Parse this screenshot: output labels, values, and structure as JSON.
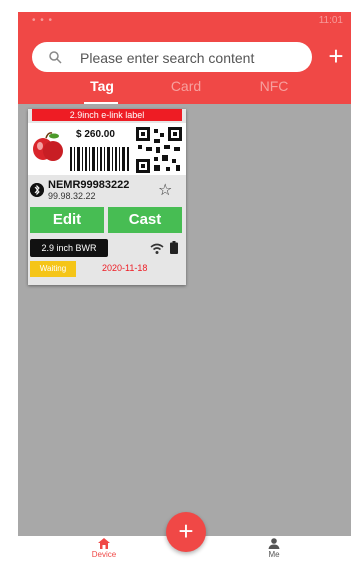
{
  "status_bar": {
    "left_text": "• • •",
    "right_text": "11:01"
  },
  "search": {
    "placeholder": "Please enter search content"
  },
  "header": {
    "add_label": "+"
  },
  "tabs": [
    {
      "label": "Tag",
      "active": true
    },
    {
      "label": "Card",
      "active": false
    },
    {
      "label": "NFC",
      "active": false
    }
  ],
  "device_card": {
    "label_title": "2.9inch e-link label",
    "price": "$ 260.00",
    "device_id": "NEMR99983222",
    "ip": "99.98.32.22",
    "edit_label": "Edit",
    "cast_label": "Cast",
    "model": "2.9 inch BWR",
    "status": "Waiting",
    "date": "2020-11-18",
    "star_icon": "star-outline-icon"
  },
  "fab": {
    "label": "+"
  },
  "bottom_nav": [
    {
      "label": "Device",
      "icon": "home-icon",
      "active": true
    },
    {
      "label": "Me",
      "icon": "person-icon",
      "active": false
    }
  ],
  "colors": {
    "primary": "#f04846",
    "green": "#47bd53",
    "warning": "#f5c518",
    "label_red": "#ee1c24"
  }
}
